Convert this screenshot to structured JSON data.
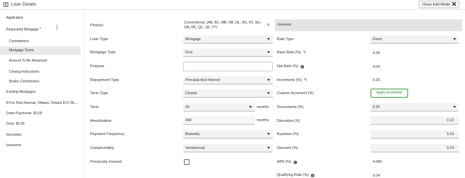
{
  "header": {
    "title": "Loan Details",
    "close_label": "Close Edit Mode"
  },
  "sidebar": {
    "items": [
      "Application",
      "Requested Mortgage ^",
      "Commitment",
      "Mortgage Terms",
      "Amount To Be Advanced",
      "Closing Instructions",
      "Broker Commission",
      "Existing Mortgages",
      "8 Fox Hunt Avenue, Ottawa, Ontario K1V 0E...",
      "Down Payments: $0.00",
      "Fees: $0.00",
      "Securities",
      "Insurance"
    ],
    "active_index": 3
  },
  "form": {
    "product": {
      "label": "Product",
      "value": "Conventional, (AB, BC, MB, NB, NL, NS, NT, NU, ON, PE, QC, SK, YT)"
    },
    "loan_type": {
      "label": "Loan Type",
      "value": "Mortgage"
    },
    "mortgage_type": {
      "label": "Mortgage Type",
      "value": "First"
    },
    "purpose": {
      "label": "Purpose",
      "value": ""
    },
    "repayment_type": {
      "label": "Repayment Type",
      "value": "Principal And Interest"
    },
    "term_type": {
      "label": "Term Type",
      "value": "Closed"
    },
    "term": {
      "label": "Term",
      "value": "60",
      "unit": "months"
    },
    "amortization": {
      "label": "Amortization",
      "value": "300",
      "unit": "months"
    },
    "payment_frequency": {
      "label": "Payment Frequency",
      "value": "Biweekly"
    },
    "compounding": {
      "label": "Compounding",
      "value": "Semiannual"
    },
    "previously_insured": {
      "label": "Previously Insured",
      "checked": false
    }
  },
  "interest": {
    "title": "Interest",
    "rate_type": {
      "label": "Rate Type",
      "value": "Fixed"
    },
    "base_rate": {
      "label": "Base Rate (%)",
      "value": "4.34"
    },
    "net_rate": {
      "label": "Net Rate (%)",
      "value": "4.04"
    },
    "increments": {
      "label": "Increments (%)",
      "value": "0.25"
    },
    "custom_increment": {
      "label": "Custom Increment (%)",
      "button_label": "Apply Increment"
    },
    "decrements": {
      "label": "Decrements (%)",
      "value": "0.25"
    },
    "discretion": {
      "label": "Discretion (%)",
      "value": "0.10"
    },
    "buydown": {
      "label": "Buydown (%)",
      "value": "0.10"
    },
    "discount": {
      "label": "Discount (%)",
      "value": "0.10"
    },
    "apr": {
      "label": "APR (%)",
      "value": "4.060"
    },
    "qualifying_rate": {
      "label": "Qualifying Rate (%)",
      "value": "6.04"
    }
  }
}
